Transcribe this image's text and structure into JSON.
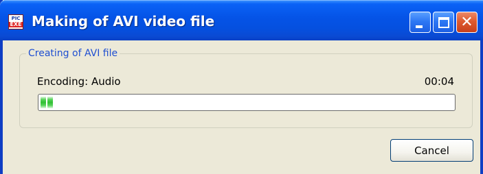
{
  "window": {
    "title": "Making of AVI video file",
    "app_icon": {
      "name": "pic-exe-icon",
      "line1": "PIC",
      "line2": "EXE"
    },
    "controls": {
      "minimize": "minimize-icon",
      "maximize": "maximize-icon",
      "close": "close-icon",
      "close_glyph": "✕"
    }
  },
  "group": {
    "title": "Creating of AVI file"
  },
  "status": {
    "label": "Encoding: Audio",
    "elapsed": "00:04"
  },
  "progress": {
    "fraction": 0.03,
    "color": "#2fbf33"
  },
  "buttons": {
    "cancel": "Cancel"
  },
  "colors": {
    "title_bar": "#0553e6",
    "group_title": "#1f4fd1",
    "face": "#ece9d8"
  }
}
